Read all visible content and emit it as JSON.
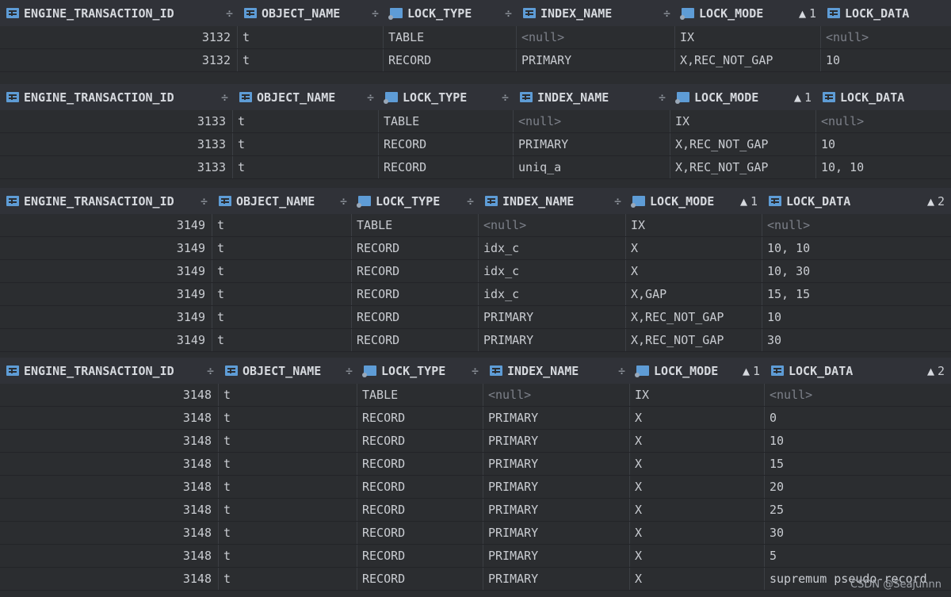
{
  "headers": {
    "engine_transaction_id": "ENGINE_TRANSACTION_ID",
    "object_name": "OBJECT_NAME",
    "lock_type": "LOCK_TYPE",
    "index_name": "INDEX_NAME",
    "lock_mode": "LOCK_MODE",
    "lock_data": "LOCK_DATA",
    "sort_mark": "÷",
    "sort_up": "▲",
    "sort_mode_rank": "1",
    "sort_data_rank": "2"
  },
  "null_text": "<null>",
  "tables": [
    {
      "rows": [
        [
          "3132",
          "t",
          "TABLE",
          "<null>",
          "IX",
          "<null>"
        ],
        [
          "3132",
          "t",
          "RECORD",
          "PRIMARY",
          "X,REC_NOT_GAP",
          "10"
        ]
      ]
    },
    {
      "rows": [
        [
          "3133",
          "t",
          "TABLE",
          "<null>",
          "IX",
          "<null>"
        ],
        [
          "3133",
          "t",
          "RECORD",
          "PRIMARY",
          "X,REC_NOT_GAP",
          "10"
        ],
        [
          "3133",
          "t",
          "RECORD",
          "uniq_a",
          "X,REC_NOT_GAP",
          "10, 10"
        ]
      ]
    },
    {
      "rows": [
        [
          "3149",
          "t",
          "TABLE",
          "<null>",
          "IX",
          "<null>"
        ],
        [
          "3149",
          "t",
          "RECORD",
          "idx_c",
          "X",
          "10, 10"
        ],
        [
          "3149",
          "t",
          "RECORD",
          "idx_c",
          "X",
          "10, 30"
        ],
        [
          "3149",
          "t",
          "RECORD",
          "idx_c",
          "X,GAP",
          "15, 15"
        ],
        [
          "3149",
          "t",
          "RECORD",
          "PRIMARY",
          "X,REC_NOT_GAP",
          "10"
        ],
        [
          "3149",
          "t",
          "RECORD",
          "PRIMARY",
          "X,REC_NOT_GAP",
          "30"
        ]
      ]
    },
    {
      "rows": [
        [
          "3148",
          "t",
          "TABLE",
          "<null>",
          "IX",
          "<null>"
        ],
        [
          "3148",
          "t",
          "RECORD",
          "PRIMARY",
          "X",
          "0"
        ],
        [
          "3148",
          "t",
          "RECORD",
          "PRIMARY",
          "X",
          "10"
        ],
        [
          "3148",
          "t",
          "RECORD",
          "PRIMARY",
          "X",
          "15"
        ],
        [
          "3148",
          "t",
          "RECORD",
          "PRIMARY",
          "X",
          "20"
        ],
        [
          "3148",
          "t",
          "RECORD",
          "PRIMARY",
          "X",
          "25"
        ],
        [
          "3148",
          "t",
          "RECORD",
          "PRIMARY",
          "X",
          "30"
        ],
        [
          "3148",
          "t",
          "RECORD",
          "PRIMARY",
          "X",
          "5"
        ],
        [
          "3148",
          "t",
          "RECORD",
          "PRIMARY",
          "X",
          "supremum pseudo-record"
        ]
      ]
    }
  ],
  "watermark": "CSDN @Seajunnn"
}
